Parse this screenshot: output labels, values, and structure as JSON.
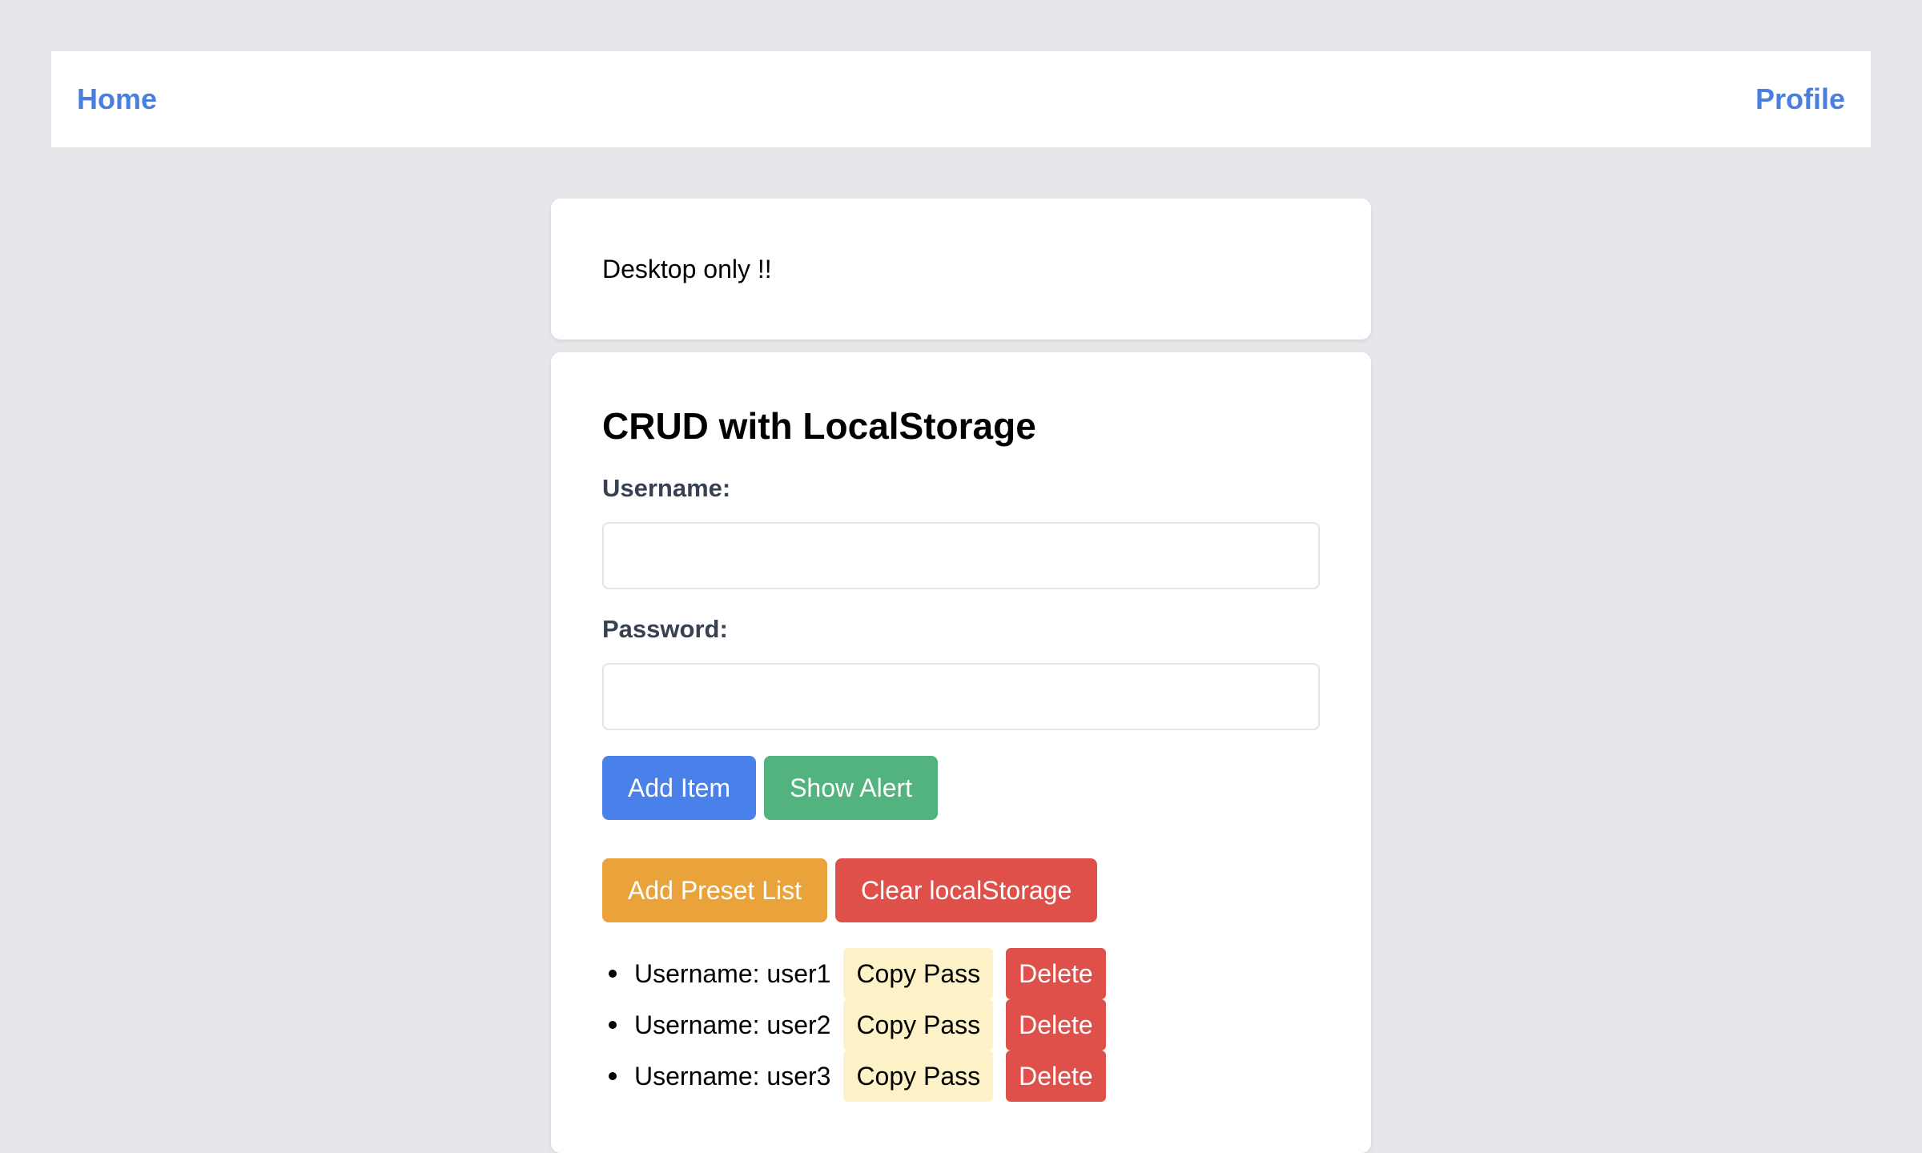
{
  "nav": {
    "home_label": "Home",
    "profile_label": "Profile"
  },
  "notice": {
    "text": "Desktop only !!"
  },
  "form": {
    "title": "CRUD with LocalStorage",
    "username_label": "Username:",
    "username_value": "",
    "password_label": "Password:",
    "password_value": ""
  },
  "buttons": {
    "add_item": "Add Item",
    "show_alert": "Show Alert",
    "add_preset": "Add Preset List",
    "clear_storage": "Clear localStorage"
  },
  "users": [
    {
      "text": "Username: user1",
      "copy": "Copy Pass",
      "delete": "Delete"
    },
    {
      "text": "Username: user2",
      "copy": "Copy Pass",
      "delete": "Delete"
    },
    {
      "text": "Username: user3",
      "copy": "Copy Pass",
      "delete": "Delete"
    }
  ],
  "colors": {
    "accent_blue": "#4a80ea",
    "success_green": "#52b37f",
    "warning_orange": "#eaa23a",
    "danger_red": "#e0504b",
    "copy_yellow": "#fdf1c7",
    "background": "#e5e7eb"
  }
}
